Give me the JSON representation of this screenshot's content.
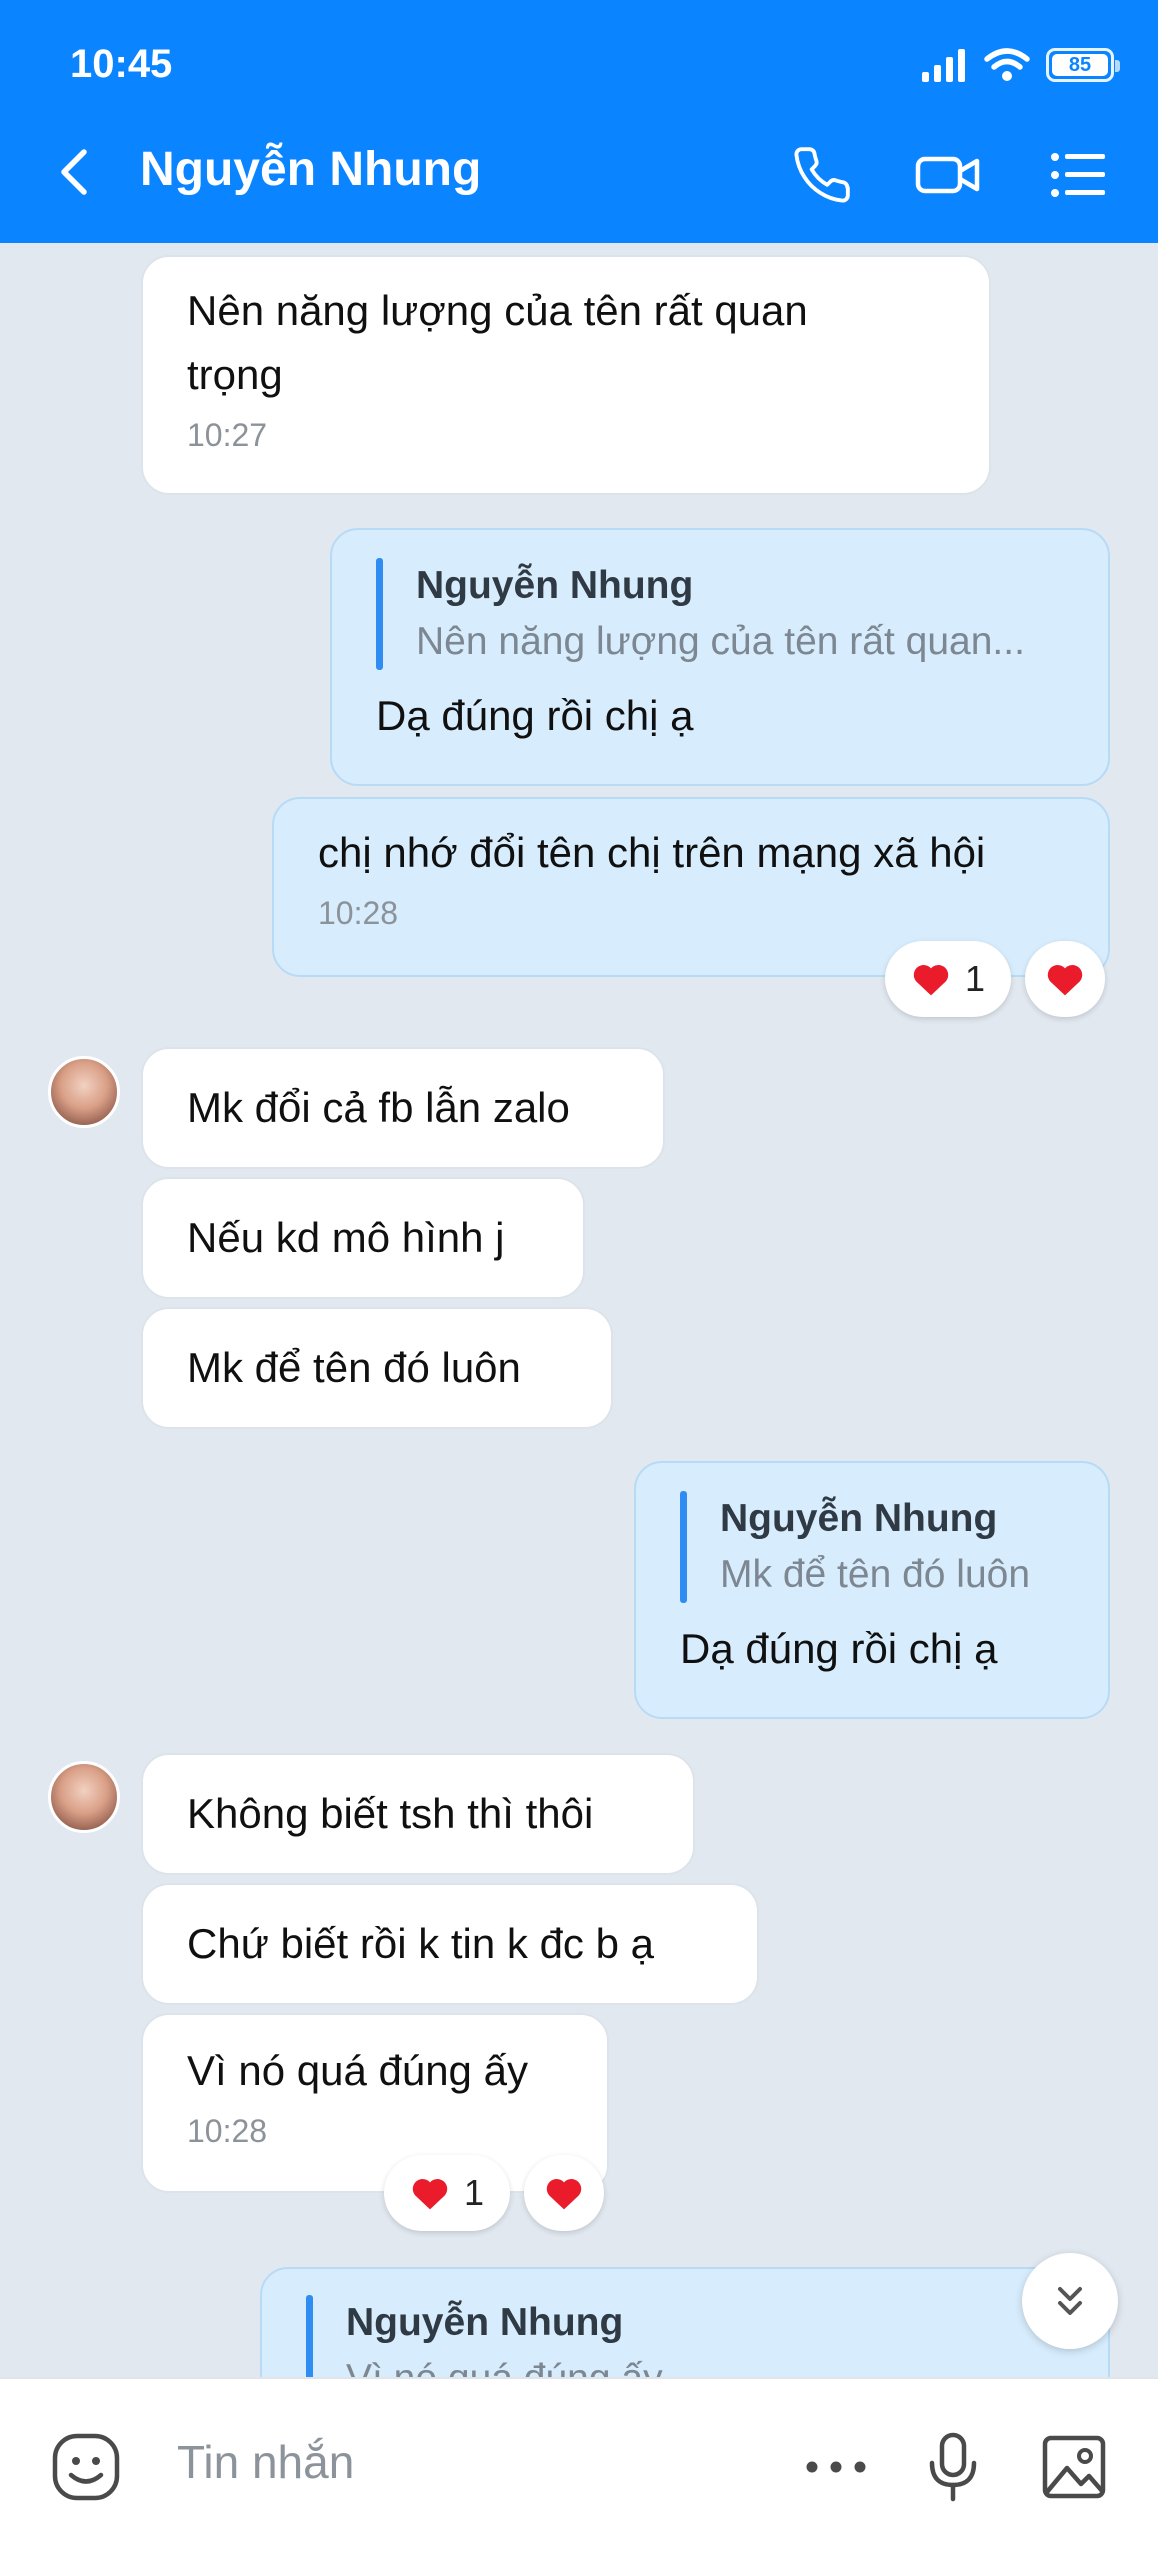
{
  "status": {
    "time": "10:45",
    "battery": "85"
  },
  "header": {
    "title": "Nguyễn Nhung"
  },
  "messages": {
    "m1": {
      "text_line1": "Nên năng lượng của tên rất quan",
      "text_line2": "trọng",
      "time": "10:27"
    },
    "m2": {
      "quote_name": "Nguyễn Nhung",
      "quote_text": "Nên năng lượng của tên rất quan...",
      "text": "Dạ đúng rồi chị ạ"
    },
    "m3": {
      "text": "chị nhớ đổi tên chị trên mạng xã hội",
      "time": "10:28",
      "reaction_count": "1"
    },
    "m4": {
      "text": "Mk đổi cả fb lẫn zalo"
    },
    "m5": {
      "text": "Nếu kd mô hình j"
    },
    "m6": {
      "text": "Mk để tên đó luôn"
    },
    "m7": {
      "quote_name": "Nguyễn Nhung",
      "quote_text": "Mk để tên đó luôn",
      "text": "Dạ đúng rồi chị ạ"
    },
    "m8": {
      "text": "Không biết tsh thì thôi"
    },
    "m9": {
      "text": "Chứ biết rồi k tin k đc b ạ"
    },
    "m10": {
      "text": "Vì nó quá đúng ấy",
      "time": "10:28",
      "reaction_count": "1"
    },
    "m11": {
      "quote_name": "Nguyễn Nhung",
      "quote_text": "Vì nó quá đúng ấy"
    }
  },
  "composer": {
    "placeholder": "Tin nhắn"
  },
  "colors": {
    "header_bg": "#0a84ff",
    "chat_bg": "#e2e8f0",
    "sent_bubble": "#d7ecfc",
    "quote_bar": "#2e8cf2",
    "heart": "#ea1c2c"
  }
}
